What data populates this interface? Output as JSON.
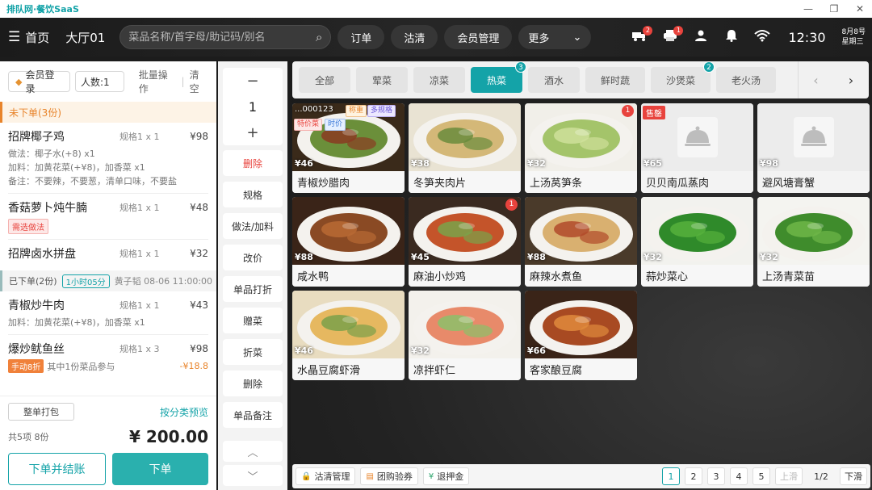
{
  "titlebar": {
    "app_title": "排队网·餐饮SaaS",
    "controls": [
      "—",
      "❐",
      "✕"
    ]
  },
  "header": {
    "home_label": "首页",
    "hall_label": "大厅01",
    "search_placeholder": "菜品名称/首字母/助记码/别名",
    "pills": [
      "订单",
      "沽清",
      "会员管理"
    ],
    "more_label": "更多",
    "icons": [
      {
        "name": "delivery-icon",
        "badge": "2"
      },
      {
        "name": "printer-icon",
        "badge": "1"
      },
      {
        "name": "user-icon",
        "badge": ""
      },
      {
        "name": "bell-icon",
        "badge": ""
      },
      {
        "name": "wifi-icon",
        "badge": ""
      }
    ],
    "time": "12:30",
    "date": "8月8号",
    "weekday": "星期三"
  },
  "order": {
    "member_login": "会员登录",
    "people": "人数:1",
    "batch_ops": "批量操作",
    "clear": "清空",
    "unordered_section": "未下单(3份)",
    "items_unordered": [
      {
        "name": "招牌椰子鸡",
        "spec": "规格1 x 1",
        "price": "¥98",
        "notes": [
          "做法：椰子水(+8) x1",
          "加料：加黄花菜(+¥8)，加香菜 x1",
          "备注：不要辣，不要葱，清单口味，不要盐"
        ]
      },
      {
        "name": "香菇萝卜炖牛腩",
        "spec": "规格1 x 1",
        "price": "¥48",
        "tag": "需选做法"
      },
      {
        "name": "招牌卤水拼盘",
        "spec": "规格1 x 1",
        "price": "¥32"
      }
    ],
    "ordered_section": "已下单(2份)",
    "ordered_time": "1小时05分",
    "ordered_by": "黄子韬 08-06 11:00:00",
    "items_ordered": [
      {
        "name": "青椒炒牛肉",
        "spec": "规格1 x 1",
        "price": "¥43",
        "notes": [
          "加料：加黄花菜(+¥8)，加香菜 x1"
        ]
      },
      {
        "name": "爆炒鱿鱼丝",
        "spec": "规格1 x 3",
        "price": "¥98",
        "discount_tag": "手动8折",
        "discount_note": "其中1份菜品参与",
        "discount_value": "-¥18.8"
      }
    ],
    "pack_all": "整单打包",
    "by_category": "按分类预览",
    "summary": "共5项 8份",
    "total": "¥ 200.00",
    "checkout_btn": "下单并结账",
    "order_btn": "下单"
  },
  "ops": {
    "minus": "−",
    "qty": "1",
    "plus": "+",
    "buttons": [
      "删除",
      "规格",
      "做法/加料",
      "改价",
      "单品打折",
      "赠菜",
      "折菜",
      "删除",
      "单品备注"
    ],
    "scroll_up": "︿",
    "scroll_down": "﹀"
  },
  "menu": {
    "categories": [
      {
        "label": "全部",
        "badge": ""
      },
      {
        "label": "荤菜",
        "badge": ""
      },
      {
        "label": "凉菜",
        "badge": ""
      },
      {
        "label": "热菜",
        "badge": "3",
        "active": true
      },
      {
        "label": "酒水",
        "badge": ""
      },
      {
        "label": "鲜时蔬",
        "badge": ""
      },
      {
        "label": "沙煲菜",
        "badge": "2"
      },
      {
        "label": "老火汤",
        "badge": ""
      }
    ],
    "dishes": [
      {
        "name": "青椒炒腊肉",
        "price": "¥46",
        "code": "...000123",
        "tags": [
          "称重",
          "多规格",
          "特价菜",
          "时价"
        ],
        "palette": [
          "#3a2a1a",
          "#6b8f3a",
          "#8a3b22"
        ]
      },
      {
        "name": "冬笋夹肉片",
        "price": "¥38",
        "palette": [
          "#e9e3d3",
          "#d4b878",
          "#6a8b3c"
        ]
      },
      {
        "name": "上汤莴笋条",
        "price": "¥32",
        "badge": "1",
        "palette": [
          "#f1efe9",
          "#a4c46a",
          "#cfe09a"
        ]
      },
      {
        "name": "贝贝南瓜蒸肉",
        "price": "¥65",
        "sold": "售罄",
        "noimg": true,
        "soldout": true
      },
      {
        "name": "避风塘膏蟹",
        "price": "¥98",
        "noimg": true
      },
      {
        "name": "咸水鸭",
        "price": "¥88",
        "palette": [
          "#3a2418",
          "#8a4a24",
          "#b86a34"
        ]
      },
      {
        "name": "麻油小炒鸡",
        "price": "¥45",
        "badge": "1",
        "palette": [
          "#3a2a20",
          "#c4542a",
          "#7aa34a"
        ]
      },
      {
        "name": "麻辣水煮鱼",
        "price": "¥88",
        "palette": [
          "#4a3a2a",
          "#d9b070",
          "#b04a2a"
        ]
      },
      {
        "name": "蒜炒菜心",
        "price": "¥32",
        "palette": [
          "#f2f2ee",
          "#2f8a2a",
          "#56b03c"
        ]
      },
      {
        "name": "上汤青菜苗",
        "price": "¥32",
        "palette": [
          "#f4f4f0",
          "#3f8c2c",
          "#6fb648"
        ]
      },
      {
        "name": "水晶豆腐虾滑",
        "price": "¥46",
        "palette": [
          "#e8dcc0",
          "#e6b860",
          "#7aa04a"
        ]
      },
      {
        "name": "凉拌虾仁",
        "price": "¥32",
        "palette": [
          "#f3f1ec",
          "#e88a6a",
          "#8cc06a"
        ]
      },
      {
        "name": "客家酿豆腐",
        "price": "¥66",
        "palette": [
          "#3a2418",
          "#a84a22",
          "#e08a3c"
        ]
      }
    ]
  },
  "bottom": {
    "actions": [
      {
        "icon": "lock-icon",
        "label": "沽清管理",
        "color": "#e8433d"
      },
      {
        "icon": "coupon-icon",
        "label": "团购验券",
        "color": "#e8842b"
      },
      {
        "icon": "deposit-icon",
        "label": "退押金",
        "color": "#2aa36a"
      }
    ],
    "pages": [
      "1",
      "2",
      "3",
      "4",
      "5"
    ],
    "prev": "上滑",
    "page_info": "1/2",
    "next": "下滑"
  }
}
